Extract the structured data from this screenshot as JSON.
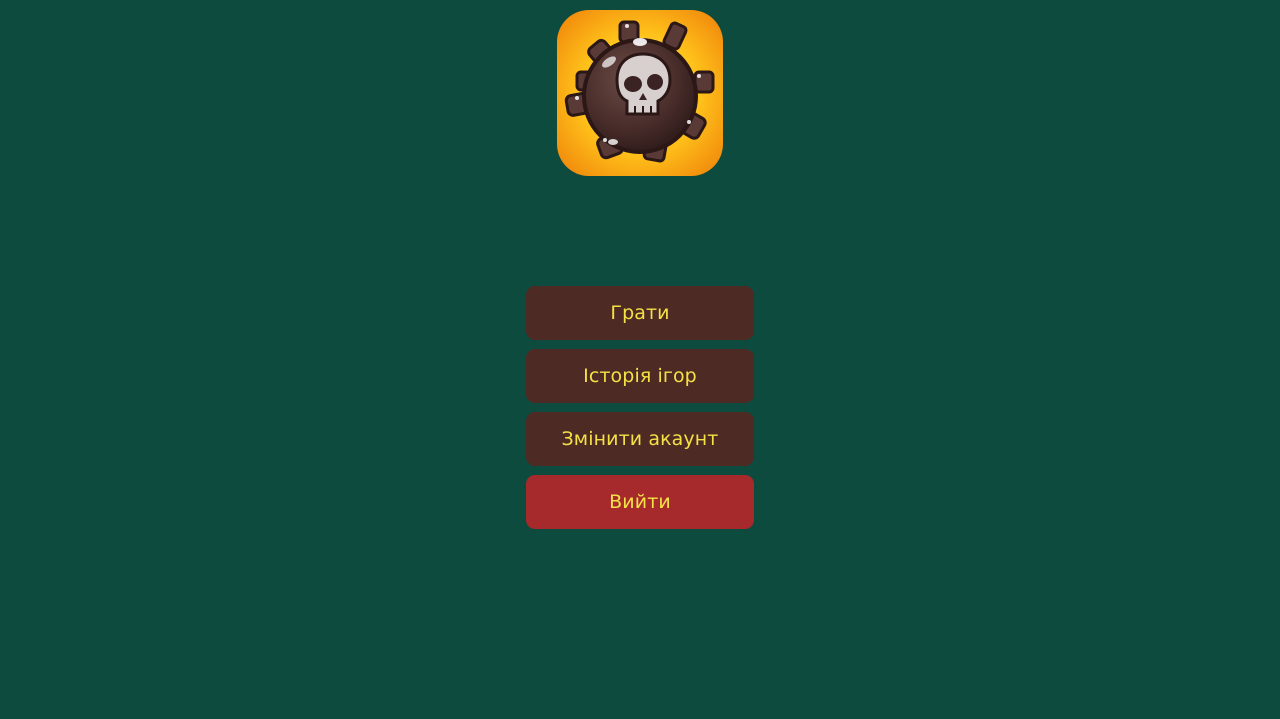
{
  "app": {
    "logo_icon": "skull-mine-icon"
  },
  "menu": {
    "play_label": "Грати",
    "history_label": "Історія ігор",
    "switch_account_label": "Змінити акаунт",
    "exit_label": "Вийти"
  },
  "colors": {
    "background": "#0d4b3e",
    "button_brown": "#4e2a24",
    "button_red": "#a6292c",
    "button_text": "#f3e146"
  }
}
